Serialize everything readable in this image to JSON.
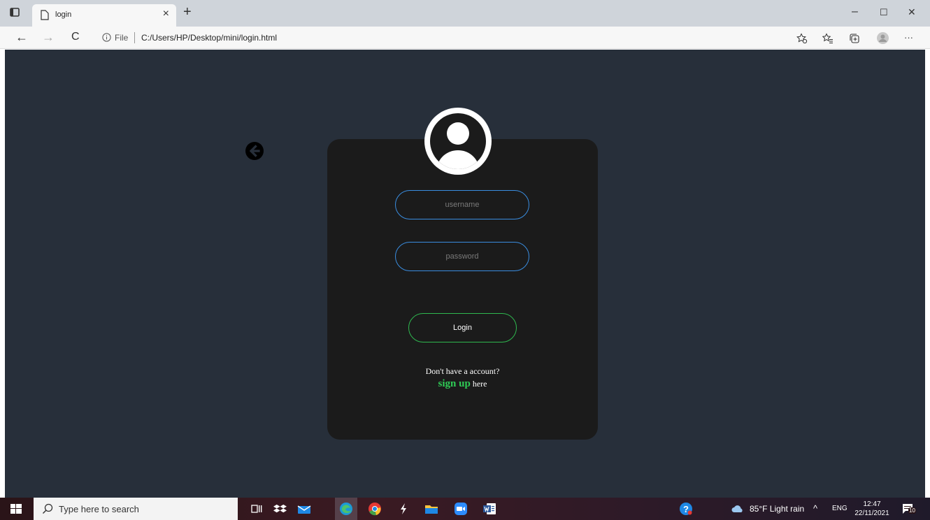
{
  "browser": {
    "tab_title": "login",
    "tab_close": "×",
    "new_tab": "+",
    "minimize": "–",
    "maximize": "☐",
    "close": "✕",
    "back": "←",
    "forward": "→",
    "refresh": "C",
    "file_label": "File",
    "url": "C:/Users/HP/Desktop/mini/login.html",
    "more": "···"
  },
  "login_form": {
    "username_placeholder": "username",
    "password_placeholder": "password",
    "login_label": "Login",
    "no_account_text": "Don't have a account?",
    "signup_link": "sign up",
    "signup_suffix": " here"
  },
  "taskbar": {
    "search_placeholder": "Type here to search",
    "weather": "85°F  Light rain",
    "language": "ENG",
    "time": "12:47",
    "date": "22/11/2021",
    "notification_count": "10"
  },
  "colors": {
    "page_bg": "#272f3a",
    "card_bg": "#1b1b1b",
    "input_border": "#3a8de0",
    "button_border": "#2fb84f",
    "signup_link": "#2fca55"
  }
}
